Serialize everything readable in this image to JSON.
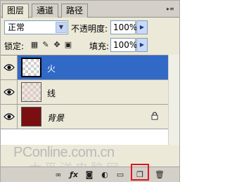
{
  "tabs": [
    {
      "label": "图层"
    },
    {
      "label": "通道"
    },
    {
      "label": "路径"
    }
  ],
  "blend": {
    "mode": "正常",
    "opacity_label": "不透明度:",
    "opacity_value": "100%"
  },
  "lock": {
    "label": "锁定:",
    "fill_label": "填充:",
    "fill_value": "100%"
  },
  "layers": [
    {
      "name": "火",
      "selected": true
    },
    {
      "name": "线",
      "selected": false
    },
    {
      "name": "背景",
      "selected": false
    }
  ],
  "watermark": {
    "text": "PConline.com.cn",
    "cn": "太平洋电脑网"
  },
  "colors": {
    "selection": "#3169c6",
    "background_thumb": "#7a0f12",
    "highlight": "#e0141e"
  },
  "icons": [
    "link-icon",
    "fx-icon",
    "mask-icon",
    "adjustment-icon",
    "group-folder-icon",
    "new-layer-icon",
    "trash-icon"
  ]
}
